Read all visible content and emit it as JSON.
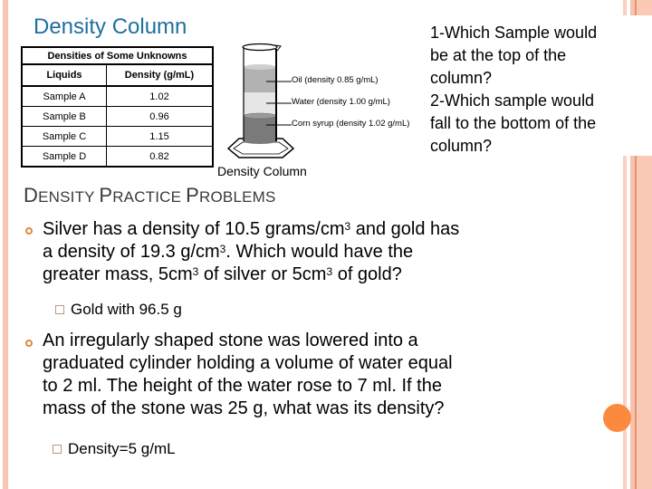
{
  "slide": {
    "image_title": "Density Column",
    "table": {
      "caption": "Densities of Some Unknowns",
      "headers": [
        "Liquids",
        "Density (g/mL)"
      ],
      "rows": [
        {
          "liquid": "Sample A",
          "density": "1.02"
        },
        {
          "liquid": "Sample B",
          "density": "0.96"
        },
        {
          "liquid": "Sample C",
          "density": "1.15"
        },
        {
          "liquid": "Sample D",
          "density": "0.82"
        }
      ]
    },
    "cylinder": {
      "layers": [
        {
          "label": "Oil (density 0.85 g/mL)",
          "color": "#b2b2b2"
        },
        {
          "label": "Water (density 1.00 g/mL)",
          "color": "#e6e6e6"
        },
        {
          "label": "Corn syrup (density 1.02 g/mL)",
          "color": "#7a7a7a"
        }
      ],
      "caption": "Density Column"
    },
    "questions": [
      "1-Which Sample would",
      "be at the top of the",
      "column?",
      "2-Which sample would",
      "fall to the bottom of the",
      "column?"
    ],
    "heading": {
      "parts": [
        {
          "big": "D",
          "small": "ENSITY "
        },
        {
          "big": "P",
          "small": "RACTICE "
        },
        {
          "big": "P",
          "small": "ROBLEMS"
        }
      ]
    },
    "problems": [
      {
        "lines": [
          {
            "pre": "Silver has a density of 10.5 grams/cm",
            "sup": "3",
            "post": " and gold has"
          },
          {
            "pre": "a density of 19.3 g/cm",
            "sup": "3",
            "post": ". Which would have the"
          },
          {
            "pre": "greater mass, 5cm",
            "sup": "3",
            "mid": " of silver or 5cm",
            "sup2": "3",
            "post": " of gold?"
          }
        ],
        "answer": "Gold with 96.5 g"
      },
      {
        "lines": [
          "An irregularly shaped stone was lowered into a",
          "graduated cylinder holding a volume of water equal",
          "to 2 ml. The height of the water rose to 7 ml. If the",
          "mass of the stone was 25 g, what was its density?"
        ],
        "answer": "Density=5 g/mL"
      }
    ],
    "colors": {
      "accent_orange": "#fb8a3f",
      "title_blue": "#1f6fa0",
      "bar_peach": "#f8c6b2"
    }
  }
}
